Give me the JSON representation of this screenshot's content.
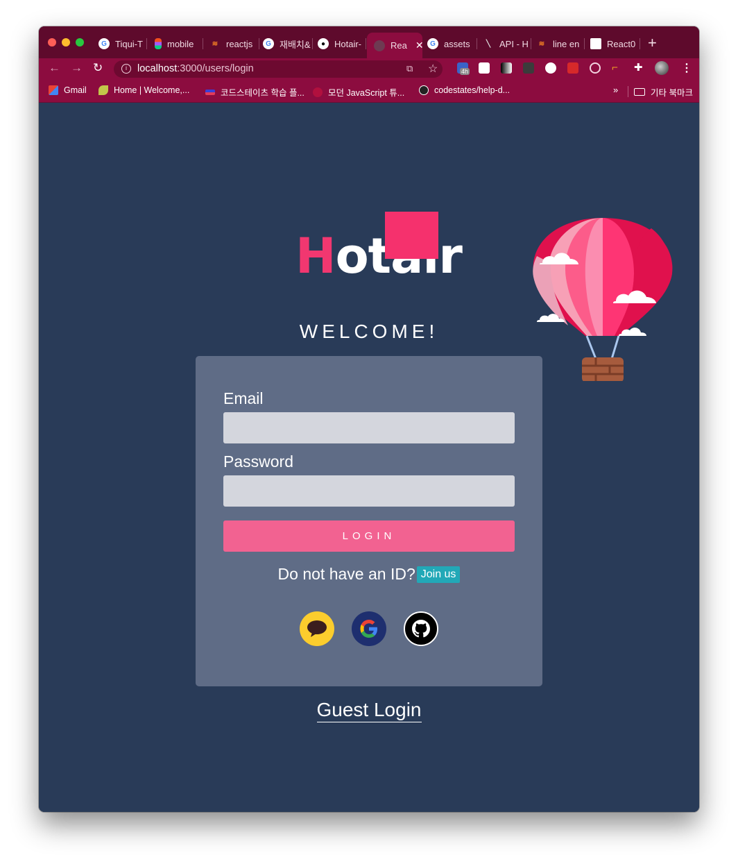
{
  "browser": {
    "tabs": [
      {
        "label": "Tiqui-T",
        "icon": "google-icon"
      },
      {
        "label": "mobile",
        "icon": "figma-icon"
      },
      {
        "label": "reactjs",
        "icon": "stackoverflow-icon"
      },
      {
        "label": "재배치&",
        "icon": "google-icon"
      },
      {
        "label": "Hotair-",
        "icon": "github-icon"
      },
      {
        "label": "Rea",
        "icon": "react-icon",
        "active": true
      },
      {
        "label": "assets",
        "icon": "google-icon"
      },
      {
        "label": "API - H",
        "icon": "pen-icon"
      },
      {
        "label": "line en",
        "icon": "stackoverflow-icon"
      },
      {
        "label": "React0",
        "icon": "page-icon"
      }
    ],
    "url_host": "localhost",
    "url_path": ":3000/users/login",
    "extension_badge": "4h",
    "bookmarks": [
      {
        "label": "Gmail",
        "icon": "gmail-icon"
      },
      {
        "label": "Home | Welcome,...",
        "icon": "leaf-icon"
      },
      {
        "label": "코드스테이츠 학습 플...",
        "icon": "codestates-icon"
      },
      {
        "label": "모던 JavaScript 튜...",
        "icon": "js-icon"
      },
      {
        "label": "codestates/help-d...",
        "icon": "github-icon"
      }
    ],
    "bookmarks_more": "»",
    "bookmarks_folder": "기타 북마크"
  },
  "page": {
    "logo_first": "H",
    "logo_rest": "otair",
    "welcome": "WELCOME!",
    "form": {
      "email_label": "Email",
      "email_value": "",
      "password_label": "Password",
      "password_value": "",
      "login_button": "LOGIN",
      "signup_prompt": "Do not have an ID?",
      "join_button": "Join us"
    },
    "social": [
      "kakao-icon",
      "google-icon",
      "github-icon"
    ],
    "guest_login": "Guest Login"
  },
  "colors": {
    "background": "#293b58",
    "card": "#5f6c86",
    "accent_pink": "#f26291",
    "logo_pink": "#f5316d",
    "join_teal": "#22a8b7",
    "browser_frame": "#8c0c3f"
  }
}
